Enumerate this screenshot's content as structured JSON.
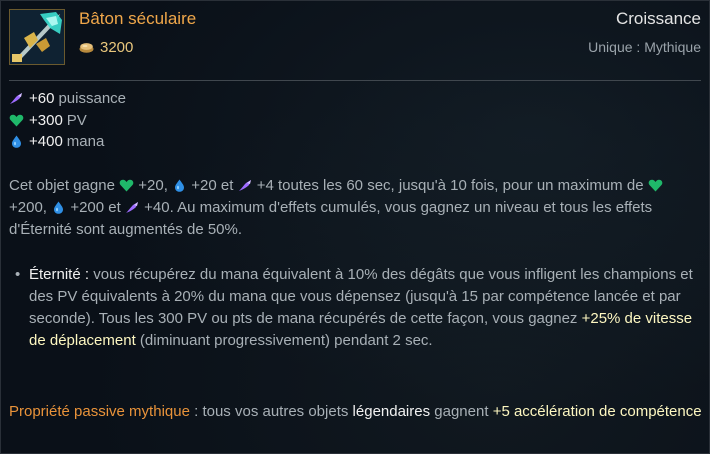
{
  "item": {
    "name": "Bâton séculaire",
    "cost": "3200",
    "category": "Croissance",
    "rarity": "Unique : Mythique",
    "icon": "staff-icon"
  },
  "stats": [
    {
      "icon": "ability-power-icon",
      "value": "+60",
      "name": "puissance",
      "color": "#9d6bff"
    },
    {
      "icon": "health-icon",
      "value": "+300",
      "name": "PV",
      "color": "#1fb86a"
    },
    {
      "icon": "mana-icon",
      "value": "+400",
      "name": "mana",
      "color": "#2f8fe5"
    }
  ],
  "description": {
    "p1_a": "Cet objet gagne",
    "p1_b": "+20,",
    "p1_c": "+20 et",
    "p1_d": "+4 toutes les 60 sec, jusqu'à 10 fois, pour un maximum de",
    "p1_e": "+200,",
    "p1_f": "+200 et",
    "p1_g": "+40. Au maximum d'effets cumulés, vous gagnez un niveau et tous les effets d'Éternité sont augmentés de 50%."
  },
  "passive": {
    "bullet": "•",
    "name": "Éternité :",
    "text_a": "vous récupérez du mana équivalent à 10% des dégâts que vous infligent les champions et des PV équivalents à 20% du mana que vous dépensez (jusqu'à 15 par compétence lancée et par seconde). Tous les 300 PV ou pts de mana récupérés de cette façon, vous gagnez",
    "highlight": "+25% de vitesse de déplacement",
    "text_b": "(diminuant progressivement) pendant 2 sec."
  },
  "mythic": {
    "title": "Propriété passive mythique",
    "sep": ":",
    "text_a": "tous vos autres objets",
    "legendary": "légendaires",
    "text_b": "gagnent",
    "bonus": "+5 accélération de compétence"
  },
  "colors": {
    "item_name": "#f0a74a",
    "gold": "#e9c77d",
    "mythic_title": "#e9933a"
  }
}
